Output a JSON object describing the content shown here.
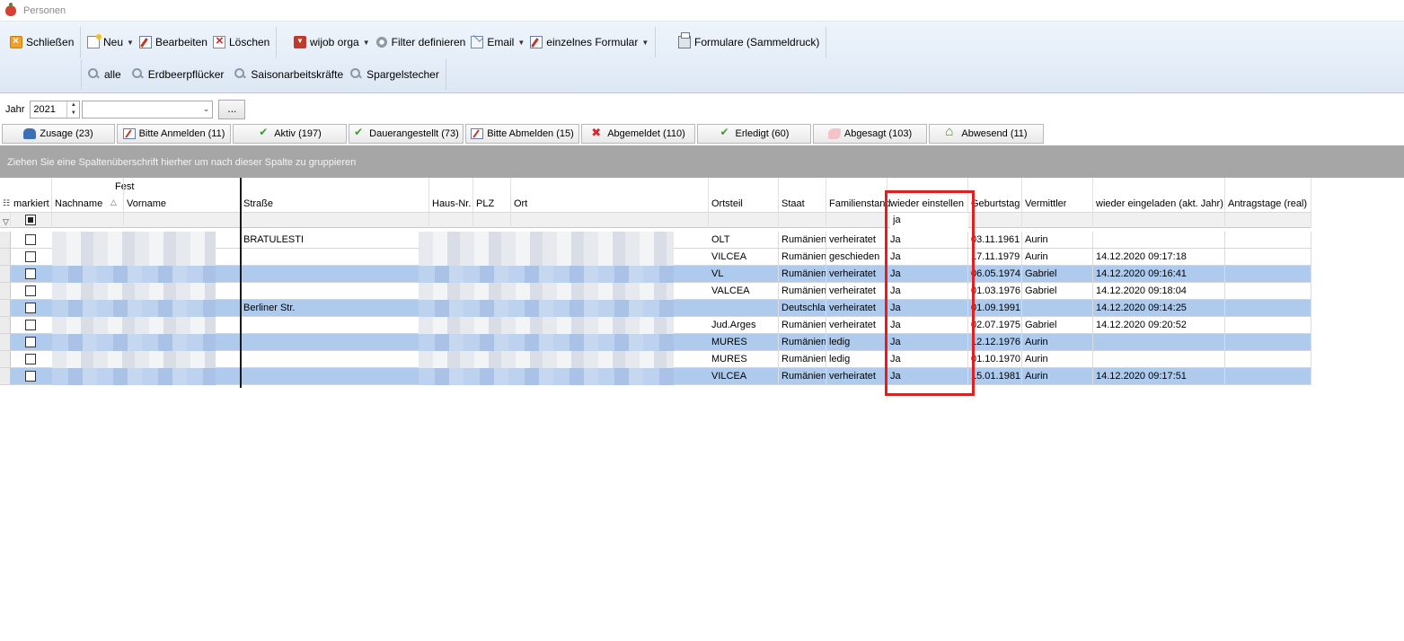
{
  "window": {
    "title": "Personen"
  },
  "toolbar": {
    "close": "Schließen",
    "new": "Neu",
    "edit": "Bearbeiten",
    "delete": "Löschen",
    "wijob": "wijob orga",
    "filter": "Filter definieren",
    "email": "Email",
    "single_form": "einzelnes Formular",
    "forms_print": "Formulare (Sammeldruck)",
    "filters": [
      "alle",
      "Erdbeerpflücker",
      "Saisonarbeitskräfte",
      "Spargelstecher"
    ]
  },
  "yearbar": {
    "label": "Jahr",
    "year": "2021",
    "combo_value": "",
    "dots": "..."
  },
  "status_tabs": [
    {
      "label": "Zusage (23)"
    },
    {
      "label": "Bitte Anmelden (11)"
    },
    {
      "label": "Aktiv (197)"
    },
    {
      "label": "Dauerangestellt (73)"
    },
    {
      "label": "Bitte Abmelden (15)"
    },
    {
      "label": "Abgemeldet (110)"
    },
    {
      "label": "Erledigt (60)"
    },
    {
      "label": "Abgesagt (103)"
    },
    {
      "label": "Abwesend (11)"
    }
  ],
  "group_hint": "Ziehen Sie eine Spaltenüberschrift hierher um nach dieser Spalte zu gruppieren",
  "grid": {
    "fest_label": "Fest",
    "columns": [
      "markiert",
      "Nachname",
      "Vorname",
      "Straße",
      "Haus-Nr.",
      "PLZ",
      "Ort",
      "Ortsteil",
      "Staat",
      "Familienstand",
      "wieder einstellen",
      "Geburtstag",
      "Vermittler",
      "wieder eingeladen (akt. Jahr)",
      "Antragstage (real)"
    ],
    "filter_wieder_einstellen": "ja",
    "rows": [
      {
        "strasse": "BRATULESTI",
        "ortsteil": "OLT",
        "staat": "Rumänien",
        "familienstand": "verheiratet",
        "wieder": "Ja",
        "geburtstag": "03.11.1961",
        "vermittler": "Aurin",
        "eingeladen": ""
      },
      {
        "strasse": "",
        "ortsteil": "VILCEA",
        "staat": "Rumänien",
        "familienstand": "geschieden",
        "wieder": "Ja",
        "geburtstag": "17.11.1979",
        "vermittler": "Aurin",
        "eingeladen": "14.12.2020 09:17:18"
      },
      {
        "strasse": "",
        "ortsteil": "VL",
        "staat": "Rumänien",
        "familienstand": "verheiratet",
        "wieder": "Ja",
        "geburtstag": "06.05.1974",
        "vermittler": "Gabriel",
        "eingeladen": "14.12.2020 09:16:41"
      },
      {
        "strasse": "",
        "ortsteil": "VALCEA",
        "staat": "Rumänien",
        "familienstand": "verheiratet",
        "wieder": "Ja",
        "geburtstag": "01.03.1976",
        "vermittler": "Gabriel",
        "eingeladen": "14.12.2020 09:18:04"
      },
      {
        "strasse": "Berliner Str.",
        "ortsteil": "",
        "staat": "Deutschland",
        "familienstand": "verheiratet",
        "wieder": "Ja",
        "geburtstag": "01.09.1991",
        "vermittler": "",
        "eingeladen": "14.12.2020 09:14:25"
      },
      {
        "strasse": "",
        "ortsteil": "Jud.Arges",
        "staat": "Rumänien",
        "familienstand": "verheiratet",
        "wieder": "Ja",
        "geburtstag": "02.07.1975",
        "vermittler": "Gabriel",
        "eingeladen": "14.12.2020 09:20:52"
      },
      {
        "strasse": "",
        "ortsteil": "MURES",
        "staat": "Rumänien",
        "familienstand": "ledig",
        "wieder": "Ja",
        "geburtstag": "12.12.1976",
        "vermittler": "Aurin",
        "eingeladen": ""
      },
      {
        "strasse": "",
        "ortsteil": "MURES",
        "staat": "Rumänien",
        "familienstand": "ledig",
        "wieder": "Ja",
        "geburtstag": "01.10.1970",
        "vermittler": "Aurin",
        "eingeladen": ""
      },
      {
        "strasse": "",
        "ortsteil": "VILCEA",
        "staat": "Rumänien",
        "familienstand": "verheiratet",
        "wieder": "Ja",
        "geburtstag": "15.01.1981",
        "vermittler": "Aurin",
        "eingeladen": "14.12.2020 09:17:51"
      }
    ]
  }
}
